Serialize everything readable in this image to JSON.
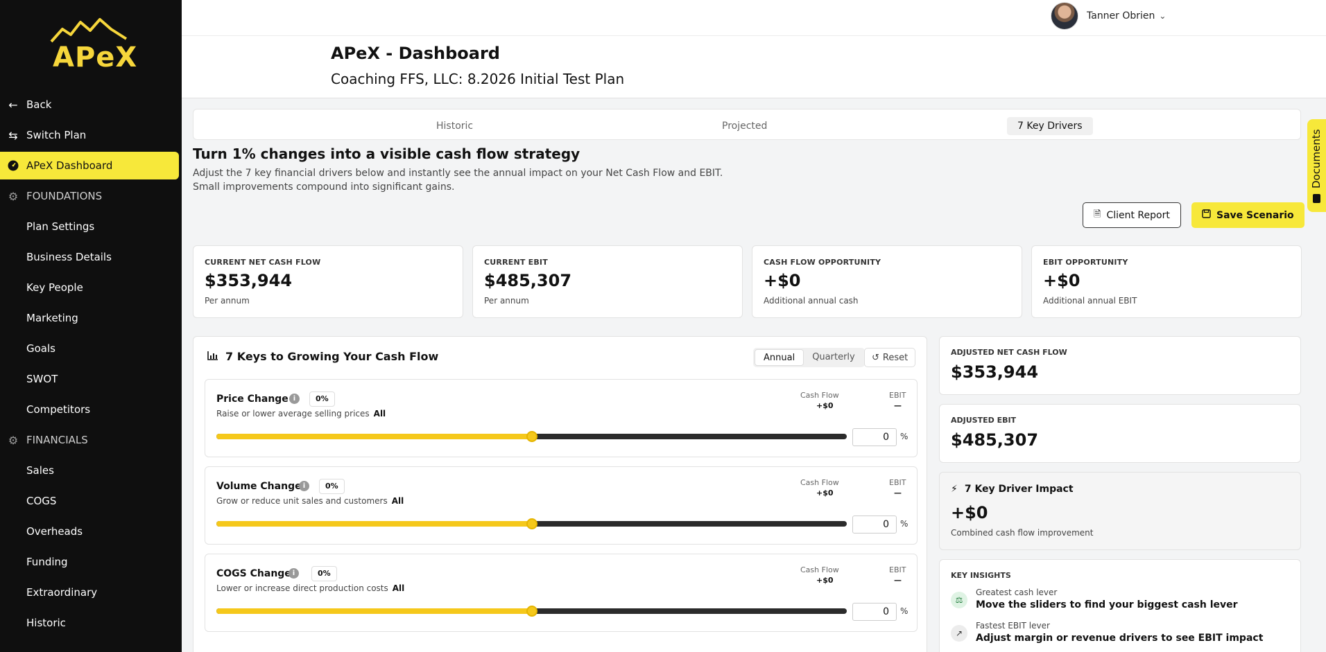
{
  "brand": {
    "logo_text": "APeX",
    "accent": "#f7e83a"
  },
  "sidebar": {
    "items": [
      {
        "label": "Back",
        "icon": "arrow-left-icon",
        "type": "top"
      },
      {
        "label": "Switch Plan",
        "icon": "swap-arrows-icon",
        "type": "top"
      },
      {
        "label": "APeX Dashboard",
        "icon": "dashboard-gauge-icon",
        "type": "active"
      },
      {
        "label": "FOUNDATIONS",
        "icon": "gear-icon",
        "type": "section"
      },
      {
        "label": "Plan Settings",
        "type": "sub"
      },
      {
        "label": "Business Details",
        "type": "sub"
      },
      {
        "label": "Key People",
        "type": "sub"
      },
      {
        "label": "Marketing",
        "type": "sub"
      },
      {
        "label": "Goals",
        "type": "sub"
      },
      {
        "label": "SWOT",
        "type": "sub"
      },
      {
        "label": "Competitors",
        "type": "sub"
      },
      {
        "label": "FINANCIALS",
        "icon": "gear-icon",
        "type": "section"
      },
      {
        "label": "Sales",
        "type": "sub"
      },
      {
        "label": "COGS",
        "type": "sub"
      },
      {
        "label": "Overheads",
        "type": "sub"
      },
      {
        "label": "Funding",
        "type": "sub"
      },
      {
        "label": "Extraordinary",
        "type": "sub"
      },
      {
        "label": "Historic",
        "type": "sub"
      }
    ]
  },
  "header": {
    "user_name": "Tanner Obrien",
    "title": "APeX - Dashboard",
    "subtitle": "Coaching FFS, LLC: 8.2026 Initial Test Plan"
  },
  "tabs": [
    {
      "label": "Historic",
      "active": false
    },
    {
      "label": "Projected",
      "active": false
    },
    {
      "label": "7 Key Drivers",
      "active": true
    }
  ],
  "intro": {
    "headline": "Turn 1% changes into a visible cash flow strategy",
    "line1": "Adjust the 7 key financial drivers below and instantly see the annual impact on your Net Cash Flow and EBIT.",
    "line2": "Small improvements compound into significant gains."
  },
  "actions": {
    "client_report": "Client Report",
    "save_scenario": "Save Scenario"
  },
  "stats": [
    {
      "label": "CURRENT NET CASH FLOW",
      "value": "$353,944",
      "sub": "Per annum"
    },
    {
      "label": "CURRENT EBIT",
      "value": "$485,307",
      "sub": "Per annum"
    },
    {
      "label": "CASH FLOW OPPORTUNITY",
      "value": "+$0",
      "sub": "Additional annual cash"
    },
    {
      "label": "EBIT OPPORTUNITY",
      "value": "+$0",
      "sub": "Additional annual EBIT"
    }
  ],
  "keys": {
    "title": "7 Keys to Growing Your Cash Flow",
    "period_options": [
      "Annual",
      "Quarterly"
    ],
    "period_selected": "Annual",
    "reset_label": "Reset",
    "cash_flow_label": "Cash Flow",
    "ebit_label": "EBIT",
    "unit": "%",
    "drivers": [
      {
        "name": "Price Change",
        "pct": "0%",
        "desc": "Raise or lower average selling prices",
        "scope": "All",
        "cash_flow": "+$0",
        "ebit": "—",
        "value": "0",
        "slider_level": 0.5
      },
      {
        "name": "Volume Change",
        "pct": "0%",
        "desc": "Grow or reduce unit sales and customers",
        "scope": "All",
        "cash_flow": "+$0",
        "ebit": "—",
        "value": "0",
        "slider_level": 0.5
      },
      {
        "name": "COGS Change",
        "pct": "0%",
        "desc": "Lower or increase direct production costs",
        "scope": "All",
        "cash_flow": "+$0",
        "ebit": "—",
        "value": "0",
        "slider_level": 0.5
      }
    ]
  },
  "adjusted": {
    "cash_label": "ADJUSTED NET CASH FLOW",
    "cash_value": "$353,944",
    "ebit_label": "ADJUSTED EBIT",
    "ebit_value": "$485,307"
  },
  "impact": {
    "title": "7 Key Driver Impact",
    "value": "+$0",
    "sub": "Combined cash flow improvement"
  },
  "insights": {
    "title": "KEY INSIGHTS",
    "items": [
      {
        "label": "Greatest cash lever",
        "text": "Move the sliders to find your biggest cash lever"
      },
      {
        "label": "Fastest EBIT lever",
        "text": "Adjust margin or revenue drivers to see EBIT impact"
      }
    ]
  },
  "documents_tab": "Documents"
}
